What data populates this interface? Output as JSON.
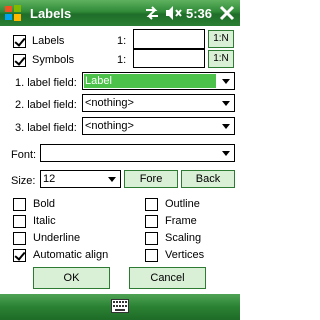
{
  "titlebar": {
    "title": "Labels",
    "time": "5:36"
  },
  "icons": {
    "start": "windows-flag-icon",
    "connectivity": "connectivity-arrows-icon",
    "volume": "speaker-muted-icon",
    "close": "close-x-icon",
    "keyboard": "keyboard-icon"
  },
  "options": {
    "labels": {
      "label": "Labels",
      "checked": true,
      "index_label": "1:",
      "value": "",
      "btn": "1:N"
    },
    "symbols": {
      "label": "Symbols",
      "checked": true,
      "index_label": "1:",
      "value": "",
      "btn": "1:N"
    }
  },
  "fields": [
    {
      "label": "1. label field:",
      "value": "Label",
      "selected": true
    },
    {
      "label": "2. label field:",
      "value": "<nothing>",
      "selected": false
    },
    {
      "label": "3. label field:",
      "value": "<nothing>",
      "selected": false
    }
  ],
  "font": {
    "label": "Font:",
    "value": ""
  },
  "size": {
    "label": "Size:",
    "value": "12",
    "fore": "Fore",
    "back": "Back"
  },
  "styles": {
    "left": [
      {
        "label": "Bold",
        "checked": false
      },
      {
        "label": "Italic",
        "checked": false
      },
      {
        "label": "Underline",
        "checked": false
      },
      {
        "label": "Automatic align",
        "checked": true
      }
    ],
    "right": [
      {
        "label": "Outline",
        "checked": false
      },
      {
        "label": "Frame",
        "checked": false
      },
      {
        "label": "Scaling",
        "checked": false
      },
      {
        "label": "Vertices",
        "checked": false
      }
    ]
  },
  "buttons": {
    "ok": "OK",
    "cancel": "Cancel"
  },
  "colors": {
    "titlebar": "#2f8a37",
    "button_fill": "#d9f0d6",
    "selection": "#4cc24a"
  }
}
